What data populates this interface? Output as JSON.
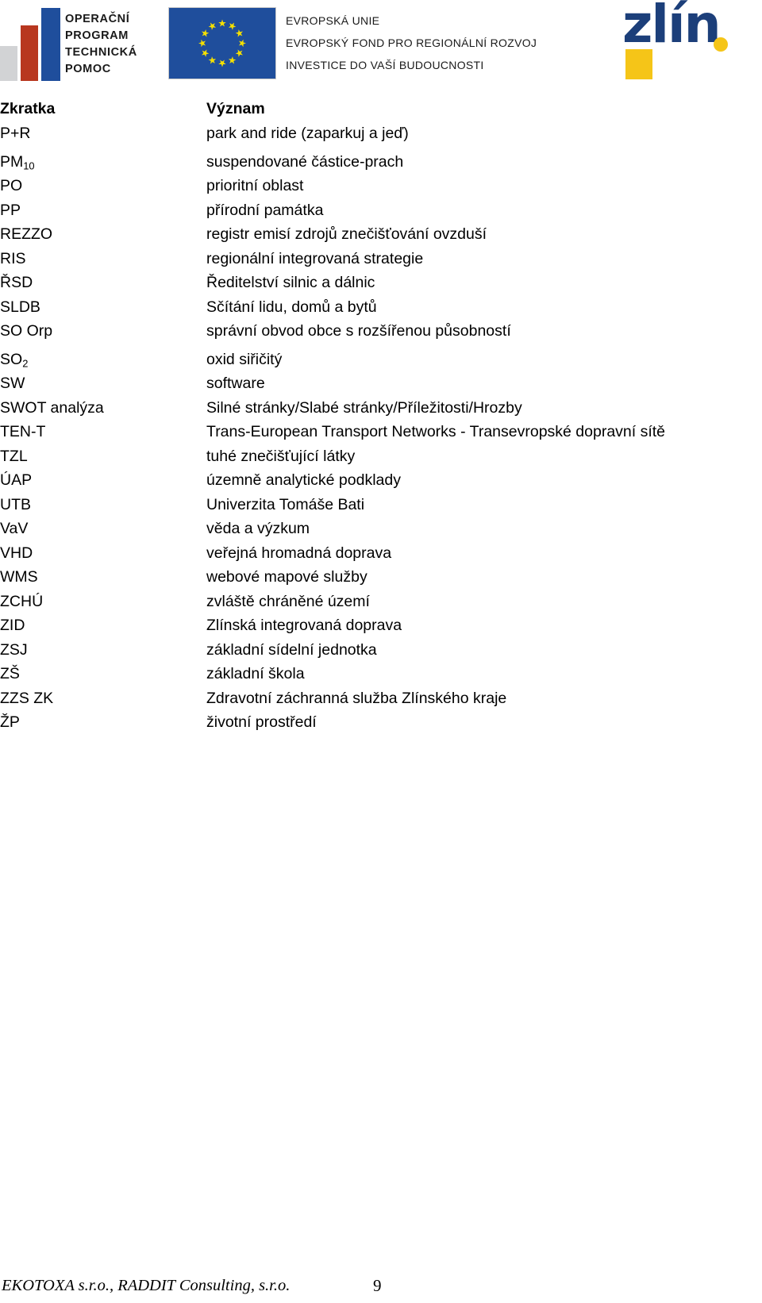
{
  "header": {
    "optp_logo": {
      "name": "operacni-program-technicka-pomoc-logo",
      "lines": "OPERAČNÍ\nPROGRAM\nTECHNICKÁ\nPOMOC",
      "colors": {
        "gray": "#d2d3d5",
        "red": "#b8371f",
        "blue": "#1f4e9c"
      }
    },
    "eu_logo": {
      "name": "european-union-flag",
      "flag_color": "#1f4e9c",
      "star_color": "#f5e000",
      "lines": "EVROPSKÁ UNIE\nEVROPSKÝ FOND PRO REGIONÁLNÍ ROZVOJ\nINVESTICE DO VAŠÍ BUDOUCNOSTI"
    },
    "zlin_logo": {
      "name": "zlin-logo",
      "wordmark": "zlín",
      "blue": "#1c3f7a",
      "yellow": "#f5c518"
    }
  },
  "table": {
    "columns": [
      "Zkratka",
      "Význam"
    ],
    "rows": [
      {
        "key": "P+R",
        "key_sub": "",
        "value": "park and ride (zaparkuj a jeď)"
      },
      {
        "key": "PM",
        "key_sub": "10",
        "value": "suspendované částice-prach"
      },
      {
        "key": "PO",
        "key_sub": "",
        "value": "prioritní oblast"
      },
      {
        "key": "PP",
        "key_sub": "",
        "value": "přírodní památka"
      },
      {
        "key": "REZZO",
        "key_sub": "",
        "value": "registr emisí zdrojů znečišťování ovzduší"
      },
      {
        "key": "RIS",
        "key_sub": "",
        "value": "regionální integrovaná strategie"
      },
      {
        "key": "ŘSD",
        "key_sub": "",
        "value": "Ředitelství silnic a dálnic"
      },
      {
        "key": "SLDB",
        "key_sub": "",
        "value": "Sčítání lidu, domů a bytů"
      },
      {
        "key": "SO Orp",
        "key_sub": "",
        "value": "správní obvod obce s rozšířenou působností"
      },
      {
        "key": "SO",
        "key_sub": "2",
        "value": "oxid siřičitý"
      },
      {
        "key": "SW",
        "key_sub": "",
        "value": "software"
      },
      {
        "key": "SWOT analýza",
        "key_sub": "",
        "value": "Silné stránky/Slabé stránky/Příležitosti/Hrozby"
      },
      {
        "key": "TEN-T",
        "key_sub": "",
        "value": "Trans-European Transport Networks - Transevropské dopravní sítě"
      },
      {
        "key": "TZL",
        "key_sub": "",
        "value": "tuhé znečišťující látky"
      },
      {
        "key": "ÚAP",
        "key_sub": "",
        "value": "územně analytické podklady"
      },
      {
        "key": "UTB",
        "key_sub": "",
        "value": "Univerzita Tomáše Bati"
      },
      {
        "key": "VaV",
        "key_sub": "",
        "value": "věda a výzkum"
      },
      {
        "key": "VHD",
        "key_sub": "",
        "value": "veřejná hromadná doprava"
      },
      {
        "key": "WMS",
        "key_sub": "",
        "value": "webové mapové služby"
      },
      {
        "key": "ZCHÚ",
        "key_sub": "",
        "value": "zvláště chráněné území"
      },
      {
        "key": "ZID",
        "key_sub": "",
        "value": "Zlínská integrovaná doprava"
      },
      {
        "key": "ZSJ",
        "key_sub": "",
        "value": "základní sídelní jednotka"
      },
      {
        "key": "ZŠ",
        "key_sub": "",
        "value": "základní škola"
      },
      {
        "key": "ZZS ZK",
        "key_sub": "",
        "value": "Zdravotní záchranná služba Zlínského kraje"
      },
      {
        "key": "ŽP",
        "key_sub": "",
        "value": "životní prostředí"
      }
    ]
  },
  "footer": {
    "credit": "EKOTOXA s.r.o., RADDIT Consulting, s.r.o.",
    "page_number": "9"
  }
}
